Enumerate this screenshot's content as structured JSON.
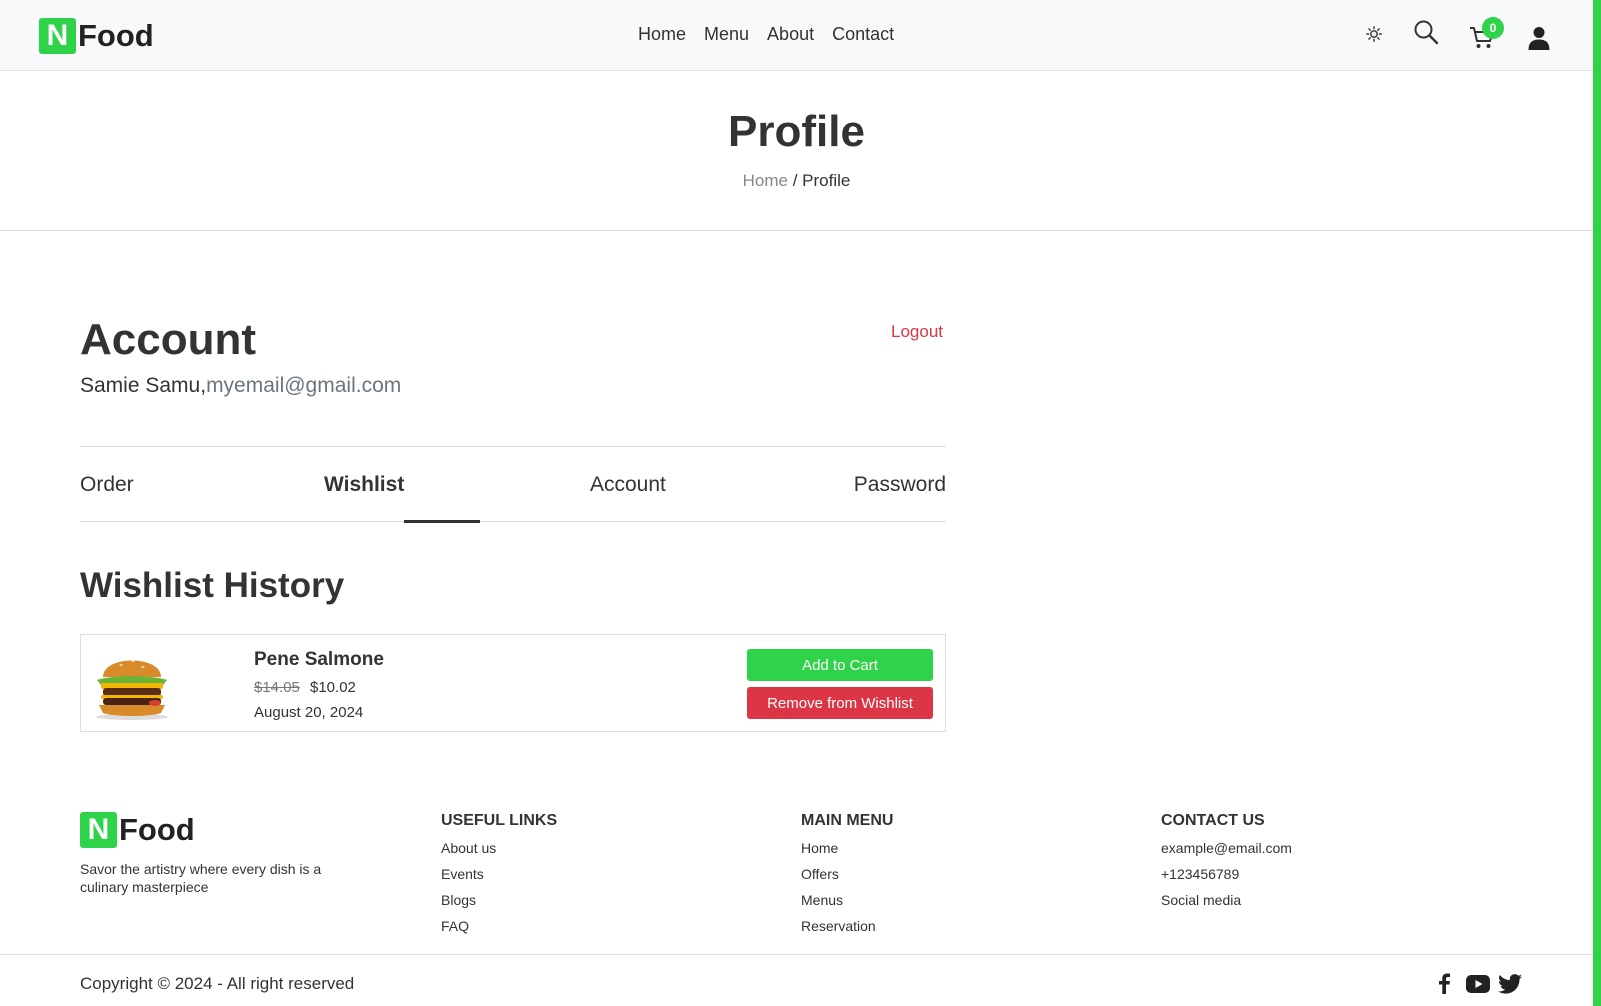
{
  "brand": {
    "letter": "N",
    "name": "Food"
  },
  "nav": {
    "home": "Home",
    "menu": "Menu",
    "about": "About",
    "contact": "Contact"
  },
  "icons": {
    "theme": "sun-icon",
    "search": "search-icon",
    "cart": "cart-icon",
    "user": "user-icon"
  },
  "cart_count": "0",
  "header": {
    "title": "Profile",
    "breadcrumb_home": "Home",
    "breadcrumb_sep": " / ",
    "breadcrumb_current": "Profile"
  },
  "account": {
    "title": "Account",
    "user_name": "Samie Samu,",
    "email": "myemail@gmail.com",
    "logout": "Logout"
  },
  "tabs": [
    {
      "label": "Order"
    },
    {
      "label": "Wishlist"
    },
    {
      "label": "Account"
    },
    {
      "label": "Password"
    }
  ],
  "wishlist": {
    "title": "Wishlist History",
    "items": [
      {
        "name": "Pene Salmone",
        "old_price": "$14.05",
        "price": "$10.02",
        "date": "August 20, 2024",
        "add_label": "Add to Cart",
        "remove_label": "Remove from Wishlist"
      }
    ]
  },
  "footer": {
    "tagline": "Savor the artistry where every dish is a culinary masterpiece",
    "useful_links": {
      "title": "USEFUL LINKS",
      "items": [
        "About us",
        "Events",
        "Blogs",
        "FAQ"
      ]
    },
    "main_menu": {
      "title": "MAIN MENU",
      "items": [
        "Home",
        "Offers",
        "Menus",
        "Reservation"
      ]
    },
    "contact": {
      "title": "CONTACT US",
      "items": [
        "example@email.com",
        "+123456789",
        "Social media"
      ]
    },
    "copyright": "Copyright © 2024 - All right reserved"
  },
  "colors": {
    "accent": "#2fd34a",
    "danger": "#dc3545"
  }
}
